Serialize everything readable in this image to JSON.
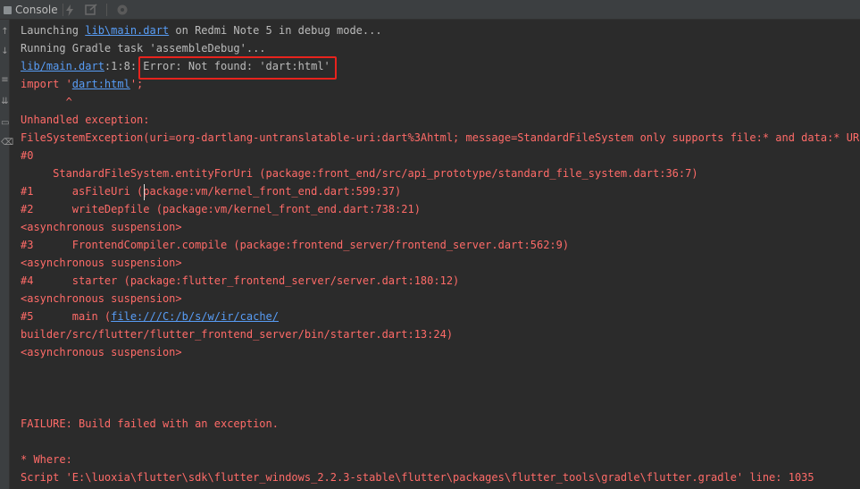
{
  "window": {
    "tab_label": "Console",
    "tab_icon": "console-icon"
  },
  "toolbar": {
    "icons": [
      "lightning-icon",
      "hot-reload-icon",
      "inspector-icon"
    ]
  },
  "gutter": {
    "icons": [
      "arrow-up-icon",
      "arrow-down-icon",
      "wrap-icon",
      "scroll-end-icon",
      "print-icon",
      "trash-icon"
    ]
  },
  "colors": {
    "error_text": "#ff6b68",
    "plain_text": "#bbbbbb",
    "link": "#589df6",
    "highlight_border": "#e8231d",
    "background": "#2b2b2b"
  },
  "console": {
    "l1_a": "Launching ",
    "l1_link": "lib\\main.dart",
    "l1_b": " on Redmi Note 5 in debug mode...",
    "l2": "Running Gradle task 'assembleDebug'...",
    "l3_link": "lib/main.dart",
    "l3_rest": ":1:8: Error: Not found: 'dart:html'",
    "l4_a": "import '",
    "l4_link": "dart:html",
    "l4_b": "';",
    "l5": "       ^",
    "l6": "Unhandled exception:",
    "l7": "FileSystemException(uri=org-dartlang-untranslatable-uri:dart%3Ahtml; message=StandardFileSystem only supports file:* and data:* URIs)",
    "l8": "#0",
    "l9": "     StandardFileSystem.entityForUri (package:front_end/src/api_prototype/standard_file_system.dart:36:7)",
    "l10": "#1      asFileUri (package:vm/kernel_front_end.dart:599:37)",
    "l11": "#2      writeDepfile (package:vm/kernel_front_end.dart:738:21)",
    "l12": "<asynchronous suspension>",
    "l13": "#3      FrontendCompiler.compile (package:frontend_server/frontend_server.dart:562:9)",
    "l14": "<asynchronous suspension>",
    "l15": "#4      starter (package:flutter_frontend_server/server.dart:180:12)",
    "l16": "<asynchronous suspension>",
    "l17_a": "#5      main (",
    "l17_link": "file:///C:/b/s/w/ir/cache/",
    "l18": "builder/src/flutter/flutter_frontend_server/bin/starter.dart:13:24)",
    "l19": "<asynchronous suspension>",
    "l20": "FAILURE: Build failed with an exception.",
    "l21": "* Where:",
    "l22": "Script 'E:\\luoxia\\flutter\\sdk\\flutter_windows_2.2.3-stable\\flutter\\packages\\flutter_tools\\gradle\\flutter.gradle' line: 1035"
  }
}
